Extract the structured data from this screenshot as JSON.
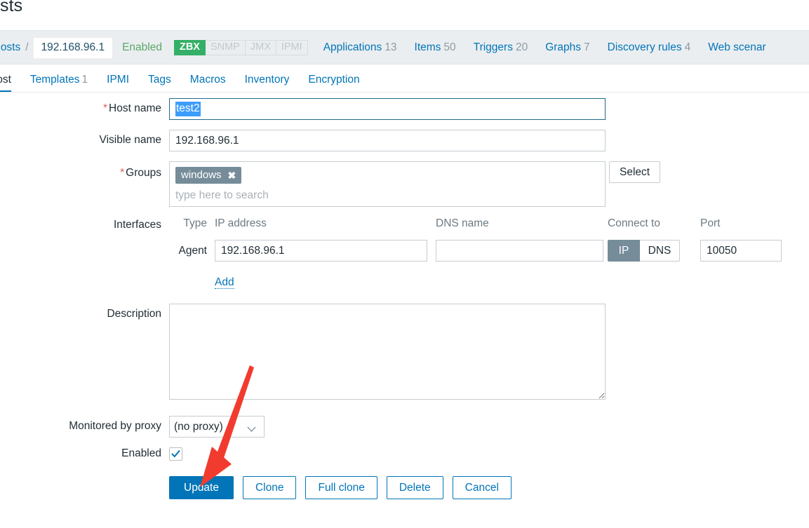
{
  "page": {
    "title": "osts"
  },
  "objectbar": {
    "all_hosts_label": "ll hosts",
    "separator": "/",
    "host_chip": "192.168.96.1",
    "status": "Enabled",
    "interface_badges": [
      {
        "label": "ZBX",
        "active": true
      },
      {
        "label": "SNMP",
        "active": false
      },
      {
        "label": "JMX",
        "active": false
      },
      {
        "label": "IPMI",
        "active": false
      }
    ],
    "links": [
      {
        "label": "Applications",
        "count": "13"
      },
      {
        "label": "Items",
        "count": "50"
      },
      {
        "label": "Triggers",
        "count": "20"
      },
      {
        "label": "Graphs",
        "count": "7"
      },
      {
        "label": "Discovery rules",
        "count": "4"
      },
      {
        "label": "Web scenar",
        "count": ""
      }
    ]
  },
  "tabs": [
    {
      "label": "Host",
      "count": "",
      "active": true
    },
    {
      "label": "Templates",
      "count": "1",
      "active": false
    },
    {
      "label": "IPMI",
      "count": "",
      "active": false
    },
    {
      "label": "Tags",
      "count": "",
      "active": false
    },
    {
      "label": "Macros",
      "count": "",
      "active": false
    },
    {
      "label": "Inventory",
      "count": "",
      "active": false
    },
    {
      "label": "Encryption",
      "count": "",
      "active": false
    }
  ],
  "form": {
    "host_name": {
      "label": "Host name",
      "required": true,
      "value": "test2",
      "selected": true
    },
    "visible_name": {
      "label": "Visible name",
      "value": "192.168.96.1"
    },
    "groups": {
      "label": "Groups",
      "required": true,
      "chips": [
        {
          "label": "windows",
          "remove_icon": "✖"
        }
      ],
      "placeholder": "type here to search",
      "select_button": "Select"
    },
    "interfaces": {
      "label": "Interfaces",
      "headers": {
        "type": "Type",
        "ip": "IP address",
        "dns": "DNS name",
        "connect_to": "Connect to",
        "port": "Port"
      },
      "rows": [
        {
          "type": "Agent",
          "ip": "192.168.96.1",
          "dns": "",
          "connect_to": "IP",
          "connect_options": [
            "IP",
            "DNS"
          ],
          "port": "10050"
        }
      ],
      "add_link": "Add"
    },
    "description": {
      "label": "Description",
      "value": ""
    },
    "proxy": {
      "label": "Monitored by proxy",
      "value": "(no proxy)",
      "options": [
        "(no proxy)"
      ]
    },
    "enabled": {
      "label": "Enabled",
      "checked": true
    }
  },
  "footer": {
    "buttons": [
      {
        "label": "Update",
        "primary": true
      },
      {
        "label": "Clone",
        "primary": false
      },
      {
        "label": "Full clone",
        "primary": false
      },
      {
        "label": "Delete",
        "primary": false
      },
      {
        "label": "Cancel",
        "primary": false
      }
    ]
  },
  "annotation": {
    "arrow_color": "#f23b2f"
  }
}
